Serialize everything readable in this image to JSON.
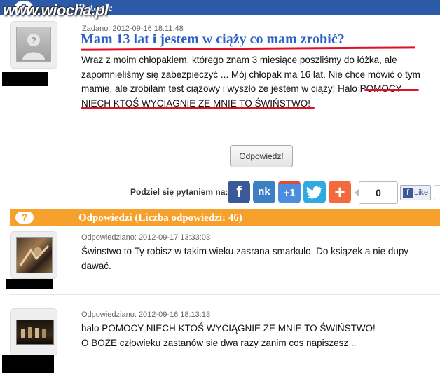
{
  "watermark": "www.wiocha.pl",
  "question_section": {
    "icon": "?",
    "title": "Pytanie"
  },
  "question": {
    "meta": "Zadano: 2012-09-16 18:11:48",
    "title": "Mam 13 lat i jestem w ciąży co mam zrobić?",
    "body": "Wraz z moim chłopakiem, którego znam 3 miesiące poszliśmy do łóżka, ale zapomnieliśmy się zabezpieczyć ... Mój chłopak ma 16 lat. Nie chce mówić o tym mamie, ale zrobiłam test ciążowy i wyszło że jestem w ciąży! Halo POMOCY NIECH KTOŚ WYCIĄGNIE ZE MNIE TO ŚWIŃSTWO!"
  },
  "answer_button": "Odpowiedz!",
  "share": {
    "label": "Podziel się pytaniem na:",
    "buttons": [
      {
        "icon": "facebook-icon",
        "glyph": "f",
        "color": "#3b5998"
      },
      {
        "icon": "nk-icon",
        "glyph": "nk",
        "color": "#3d7fc4"
      },
      {
        "icon": "google-plus-one-icon",
        "glyph": "+1",
        "color": "#4d8de0"
      },
      {
        "icon": "twitter-icon",
        "glyph": "t",
        "color": "#2fa9e1"
      },
      {
        "icon": "add-plus-icon",
        "glyph": "+",
        "color": "#f26a3d"
      }
    ],
    "count": "0",
    "like_label": "Like"
  },
  "answers_section": {
    "icon": "?",
    "title": "Odpowiedzi (Liczba odpowiedzi: 46)"
  },
  "answers": [
    {
      "meta": "Odpowiedziano: 2012-09-17 13:33:03",
      "text": "Świnstwo to Ty robisz w takim wieku zasrana smarkulo. Do ksiązek a nie dupy dawać."
    },
    {
      "meta": "Odpowiedziano: 2012-09-16 18:13:13",
      "text_line1": "halo POMOCY NIECH KTOŚ WYCIĄGNIE ZE MNIE TO ŚWIŃSTWO!",
      "text_line2": "O BOŻE człowieku zastanów sie dwa razy zanim cos napiszesz .."
    }
  ],
  "colors": {
    "question_bar": "#2b5aa6",
    "answers_bar": "#f5a12b",
    "title_link": "#2a62c4",
    "highlight_underline": "#e0102a"
  }
}
